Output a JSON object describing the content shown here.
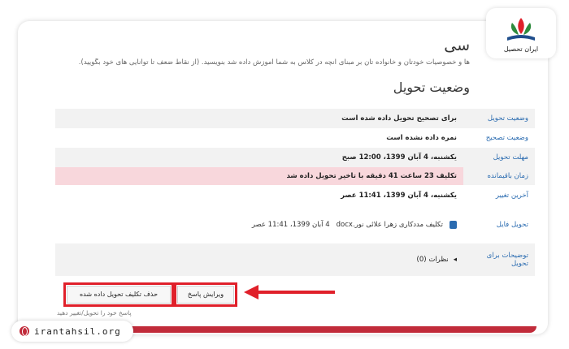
{
  "page": {
    "heading": "سی",
    "subtitle": "ها و خصوصیات خودتان و خانواده تان بر مبنای آنچه در کلاس به شما آموزش داده شد بنویسید. (از نقاط ضعف تا توانایی های خود بگویید).",
    "section_title": "وضعیت تحویل"
  },
  "status_rows": [
    {
      "label": "وضعیت تحویل",
      "value": "برای تصحیح تحویل داده شده است"
    },
    {
      "label": "وضعیت تصحیح",
      "value": "نمره داده نشده است"
    },
    {
      "label": "مهلت تحویل",
      "value": "یکشنبه، 4 آبان 1399، 12:00 صبح"
    },
    {
      "label": "زمان باقیمانده",
      "value": "تکلیف 23 ساعت 41 دقیقه با تاخیر تحویل داده شد"
    },
    {
      "label": "آخرین تغییر",
      "value": "یکشنبه، 4 آبان 1399، 11:41 عصر"
    },
    {
      "label": "تحویل فایل",
      "file_name": "تکلیف مددکاری زهرا علائی نور.docx",
      "file_date": "4 آبان 1399، 11:41 عصر"
    },
    {
      "label": "توضیحات برای تحویل",
      "comments": "نظرات (0)"
    }
  ],
  "buttons": {
    "edit_submission": "ویرایش پاسخ",
    "remove_submission": "حذف تکلیف تحویل داده شده"
  },
  "note": "پاسخ خود را تحویل/تغییر دهید",
  "watermark": {
    "logo_text": "ایران تحصیل",
    "site": "irantahsil.org"
  },
  "colors": {
    "accent_red": "#e0202a",
    "brand_red": "#c12b3a",
    "late_row_bg": "#f8d7dc",
    "link_blue": "#2a6bb0"
  }
}
